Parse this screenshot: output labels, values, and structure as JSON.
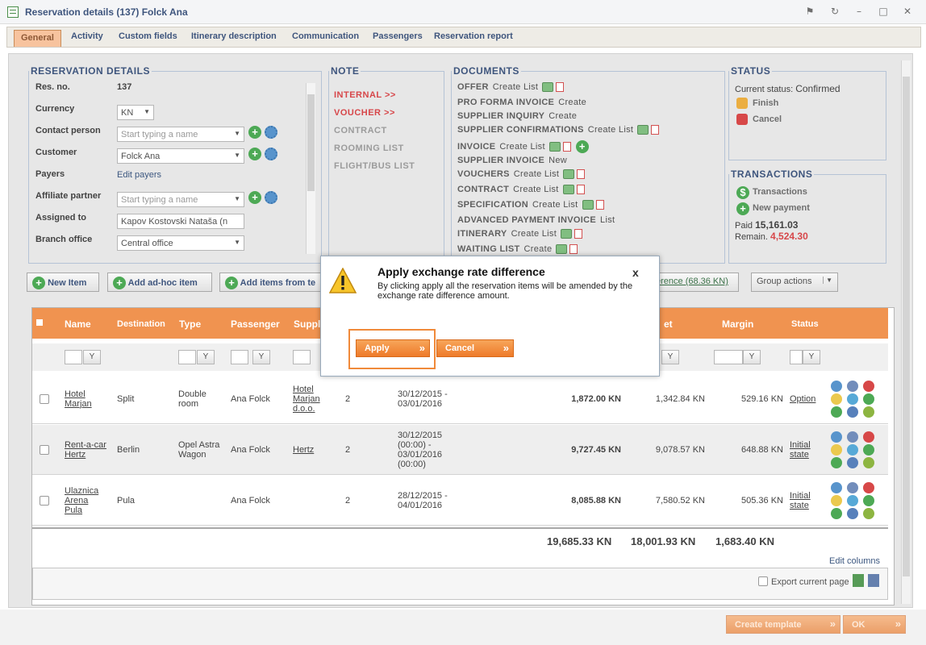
{
  "window": {
    "title": "Reservation details (137) Folck Ana"
  },
  "tabs": [
    "General",
    "Activity",
    "Custom fields",
    "Itinerary description",
    "Communication",
    "Passengers",
    "Reservation report"
  ],
  "reservation": {
    "legend": "RESERVATION DETAILS",
    "res_no_label": "Res. no.",
    "res_no": "137",
    "currency_label": "Currency",
    "currency": "KN",
    "contact_label": "Contact person",
    "contact_placeholder": "Start typing a name",
    "customer_label": "Customer",
    "customer": "Folck Ana",
    "payers_label": "Payers",
    "payers_link": "Edit payers",
    "affiliate_label": "Affiliate partner",
    "affiliate_placeholder": "Start typing a name",
    "assigned_label": "Assigned to",
    "assigned": "Kapov Kostovski Nataša (n",
    "branch_label": "Branch office",
    "branch": "Central office"
  },
  "note": {
    "legend": "NOTE",
    "items": [
      "INTERNAL >>",
      "VOUCHER >>",
      "CONTRACT",
      "ROOMING LIST",
      "FLIGHT/BUS LIST"
    ]
  },
  "documents": {
    "legend": "DOCUMENTS",
    "items": [
      {
        "name": "OFFER",
        "links": "Create  List"
      },
      {
        "name": "PRO FORMA INVOICE",
        "links": "Create"
      },
      {
        "name": "SUPPLIER INQUIRY",
        "links": "Create"
      },
      {
        "name": "SUPPLIER CONFIRMATIONS",
        "links": "Create  List"
      },
      {
        "name": "INVOICE",
        "links": "Create  List"
      },
      {
        "name": "SUPPLIER INVOICE",
        "links": "New"
      },
      {
        "name": "VOUCHERS",
        "links": "Create  List"
      },
      {
        "name": "CONTRACT",
        "links": "Create  List"
      },
      {
        "name": "SPECIFICATION",
        "links": "Create  List"
      },
      {
        "name": "ADVANCED PAYMENT INVOICE",
        "links": "List"
      },
      {
        "name": "ITINERARY",
        "links": "Create  List"
      },
      {
        "name": "WAITING LIST",
        "links": "Create"
      }
    ]
  },
  "status": {
    "legend": "STATUS",
    "current_label": "Current status:",
    "current": "Confirmed",
    "finish": "Finish",
    "cancel": "Cancel"
  },
  "transactions": {
    "legend": "TRANSACTIONS",
    "link": "Transactions",
    "new_payment": "New payment",
    "paid_label": "Paid",
    "paid": "15,161.03",
    "remain_label": "Remain.",
    "remain": "4,524.30"
  },
  "actions": {
    "new_item": "New Item",
    "add_adhoc": "Add ad-hoc item",
    "add_from": "Add items from te",
    "difference": "erence (68.36 KN)",
    "group_actions": "Group actions"
  },
  "table": {
    "headers": [
      "Name",
      "Destination",
      "Type",
      "Passenger",
      "Suppl",
      "et",
      "Margin",
      "Status"
    ],
    "rows": [
      {
        "name": "Hotel Marjan",
        "dest": "Split",
        "type": "Double room",
        "pass": "Ana Folck",
        "supp": "Hotel Marjan d.o.o.",
        "qty": "2",
        "dates": "30/12/2015 - 03/01/2016",
        "total": "1,872.00 KN",
        "net": "1,342.84 KN",
        "margin": "529.16 KN",
        "status": "Option"
      },
      {
        "name": "Rent-a-car Hertz",
        "dest": "Berlin",
        "type": "Opel Astra Wagon",
        "pass": "Ana Folck",
        "supp": "Hertz",
        "qty": "2",
        "dates": "30/12/2015 (00:00) - 03/01/2016 (00:00)",
        "total": "9,727.45 KN",
        "net": "9,078.57 KN",
        "margin": "648.88 KN",
        "status": "Initial state"
      },
      {
        "name": "Ulaznica Arena Pula",
        "dest": "Pula",
        "type": "",
        "pass": "Ana Folck",
        "supp": "",
        "qty": "2",
        "dates": "28/12/2015 - 04/01/2016",
        "total": "8,085.88 KN",
        "net": "7,580.52 KN",
        "margin": "505.36 KN",
        "status": "Initial state"
      }
    ],
    "totals": {
      "total": "19,685.33 KN",
      "net": "18,001.93 KN",
      "margin": "1,683.40 KN"
    },
    "edit_columns": "Edit columns",
    "export": "Export current page"
  },
  "dialog": {
    "title": "Apply exchange rate difference",
    "body": "By clicking apply all the reservation items will be amended by the exchange rate difference amount.",
    "apply": "Apply",
    "cancel": "Cancel",
    "close": "x"
  },
  "footer": {
    "create_template": "Create template",
    "ok": "OK"
  }
}
